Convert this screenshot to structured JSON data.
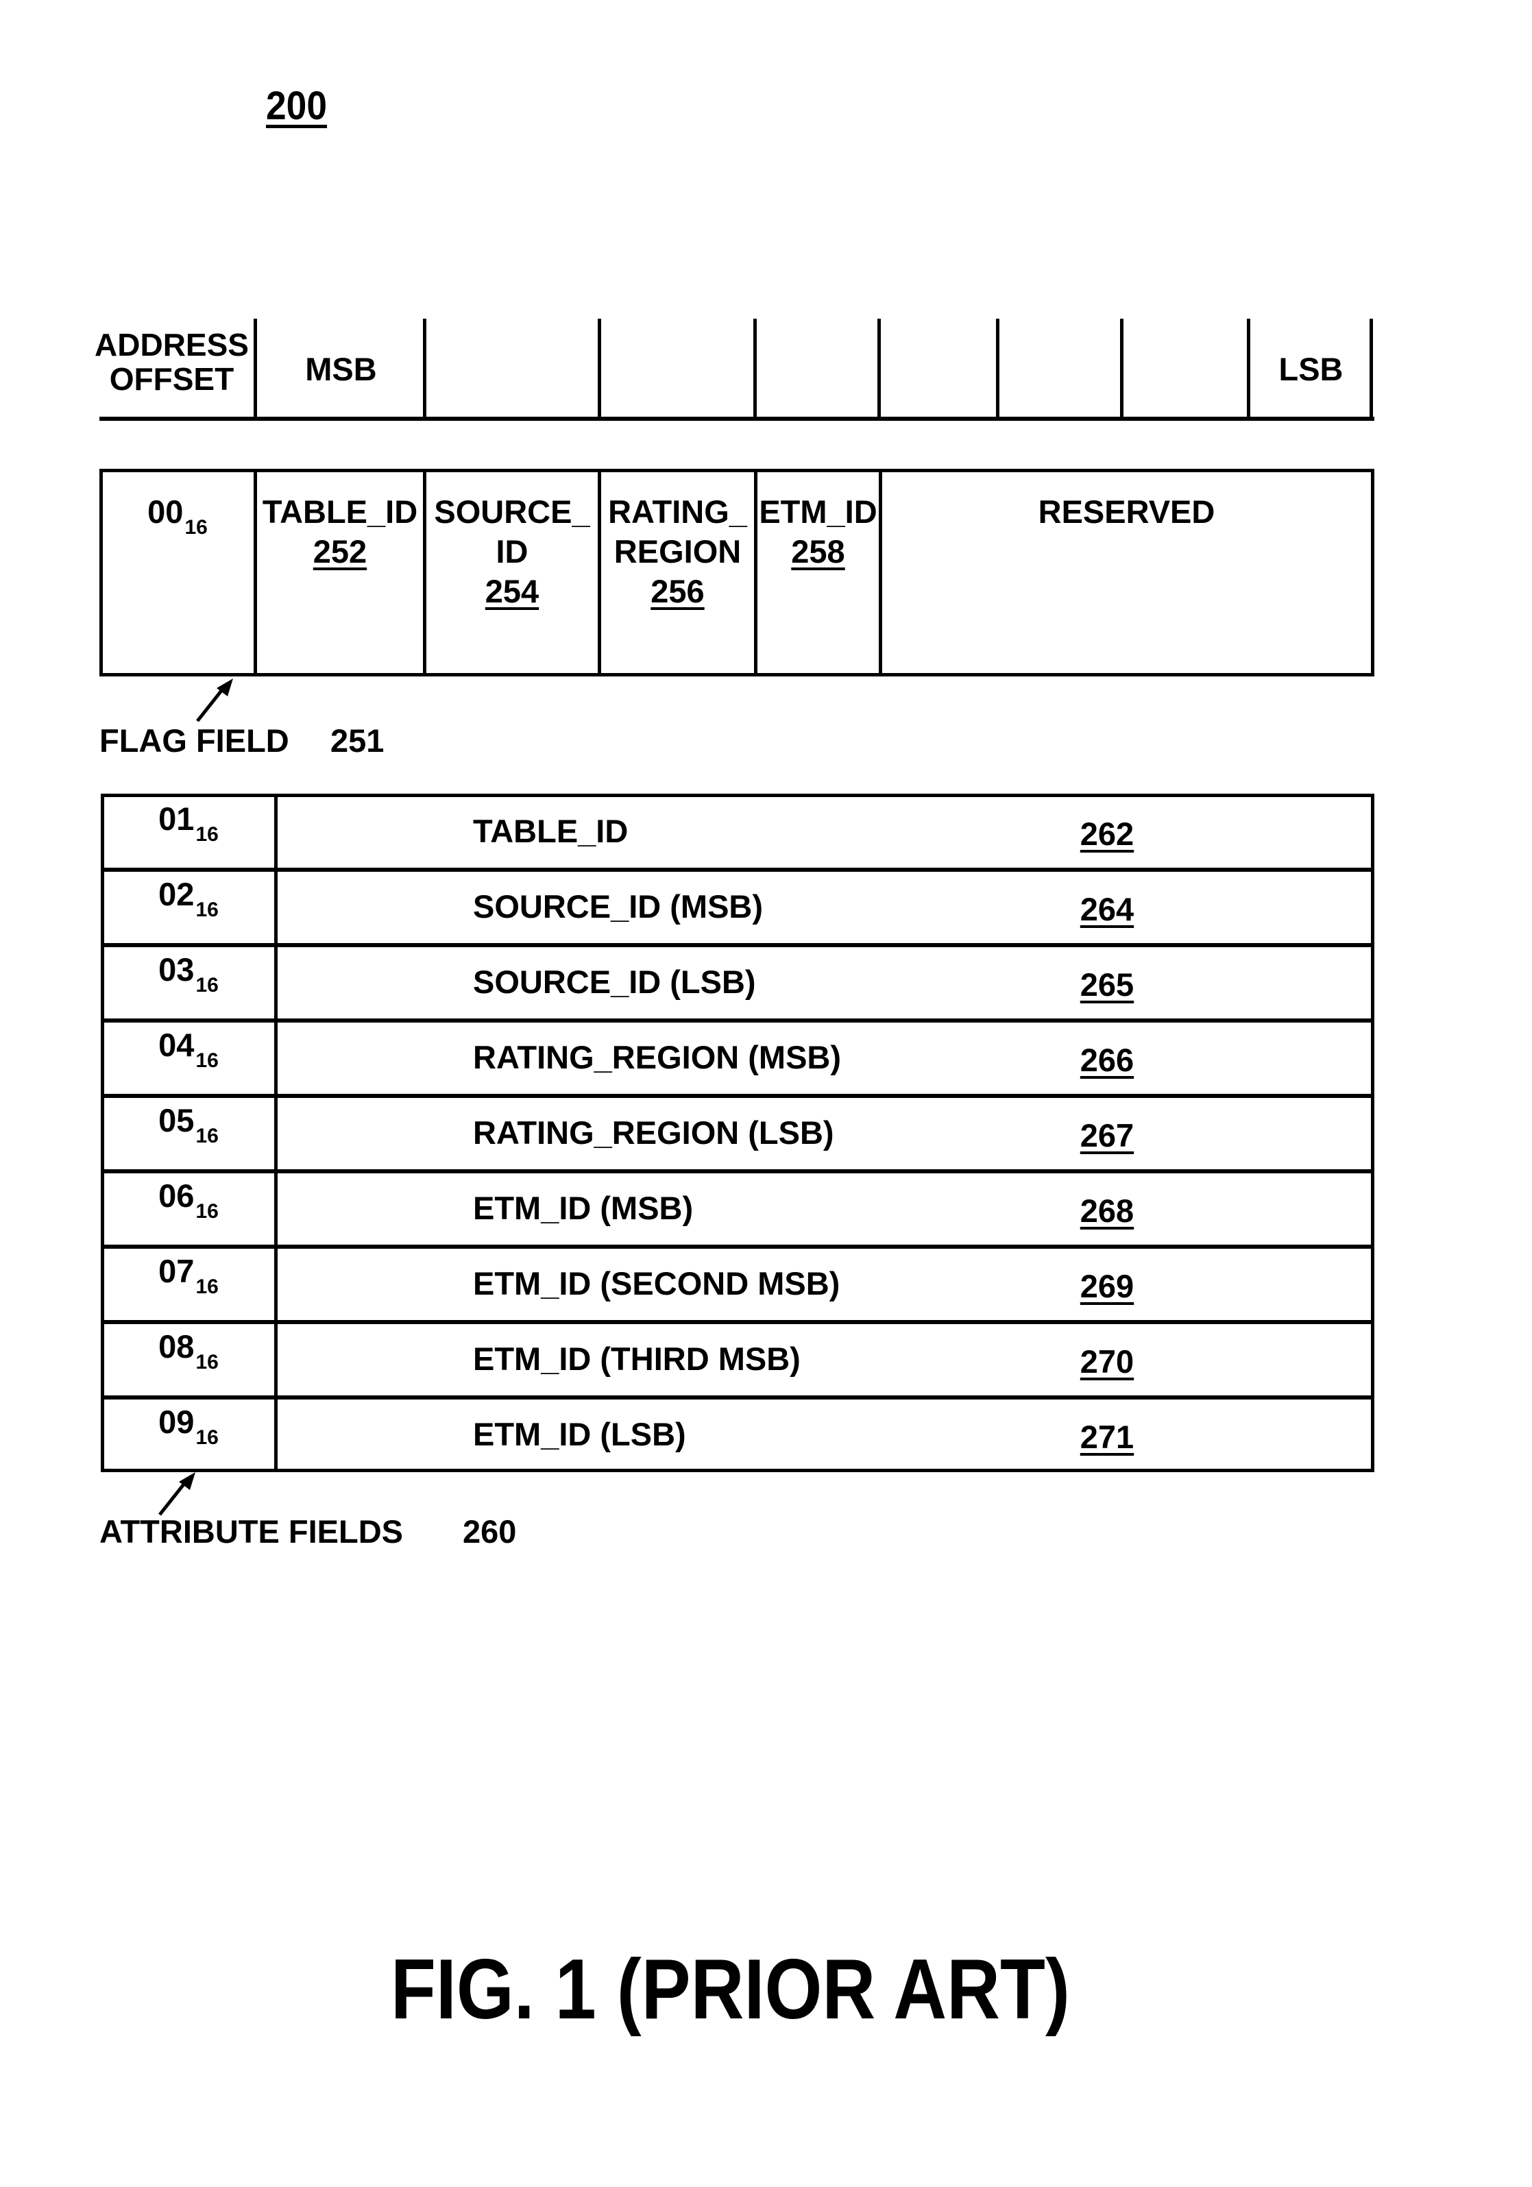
{
  "figure_number": "200",
  "header_row": {
    "address_offset_label": [
      "ADDRESS",
      "OFFSET"
    ],
    "msb_label": "MSB",
    "lsb_label": "LSB",
    "bit_columns": 8
  },
  "flag_field": {
    "offset": "00",
    "offset_base": "16",
    "cells": [
      {
        "lines": [
          "TABLE_ID"
        ],
        "ref": "252"
      },
      {
        "lines": [
          "SOURCE_",
          "ID"
        ],
        "ref": "254"
      },
      {
        "lines": [
          "RATING_",
          "REGION"
        ],
        "ref": "256"
      },
      {
        "lines": [
          "ETM_ID"
        ],
        "ref": "258"
      },
      {
        "lines": [
          "RESERVED"
        ],
        "ref": ""
      }
    ],
    "caption": "FLAG FIELD",
    "caption_ref": "251"
  },
  "attribute_fields": {
    "rows": [
      {
        "offset": "01",
        "base": "16",
        "name": "TABLE_ID",
        "ref": "262"
      },
      {
        "offset": "02",
        "base": "16",
        "name": "SOURCE_ID (MSB)",
        "ref": "264"
      },
      {
        "offset": "03",
        "base": "16",
        "name": "SOURCE_ID (LSB)",
        "ref": "265"
      },
      {
        "offset": "04",
        "base": "16",
        "name": "RATING_REGION (MSB)",
        "ref": "266"
      },
      {
        "offset": "05",
        "base": "16",
        "name": "RATING_REGION (LSB)",
        "ref": "267"
      },
      {
        "offset": "06",
        "base": "16",
        "name": "ETM_ID (MSB)",
        "ref": "268"
      },
      {
        "offset": "07",
        "base": "16",
        "name": "ETM_ID (SECOND MSB)",
        "ref": "269"
      },
      {
        "offset": "08",
        "base": "16",
        "name": "ETM_ID (THIRD MSB)",
        "ref": "270"
      },
      {
        "offset": "09",
        "base": "16",
        "name": "ETM_ID (LSB)",
        "ref": "271"
      }
    ],
    "caption": "ATTRIBUTE FIELDS",
    "caption_ref": "260"
  },
  "figure_caption": "FIG. 1 (PRIOR ART)"
}
